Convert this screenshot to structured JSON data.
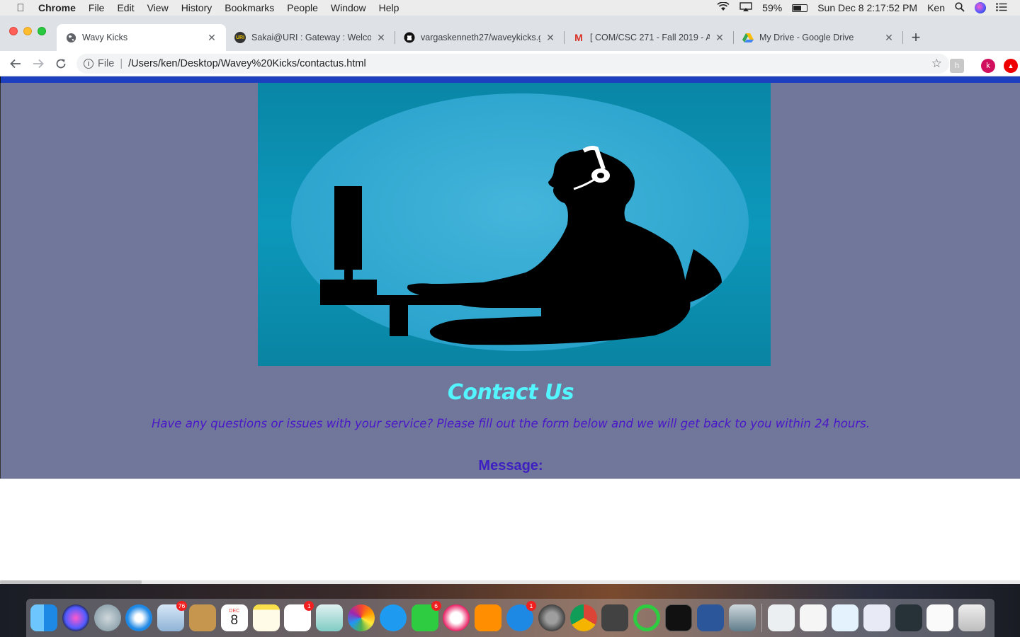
{
  "menubar": {
    "app_name": "Chrome",
    "menus": [
      "File",
      "Edit",
      "View",
      "History",
      "Bookmarks",
      "People",
      "Window",
      "Help"
    ],
    "battery": "59%",
    "clock": "Sun Dec 8  2:17:52 PM",
    "user": "Ken"
  },
  "browser": {
    "tabs": [
      {
        "title": "Wavy Kicks",
        "active": true
      },
      {
        "title": "Sakai@URI : Gateway : Welcome",
        "active": false
      },
      {
        "title": "vargaskenneth27/waveykicks.g",
        "active": false
      },
      {
        "title": "[ COM/CSC 271 - Fall 2019 - A",
        "active": false
      },
      {
        "title": "My Drive - Google Drive",
        "active": false
      }
    ],
    "address": {
      "scheme": "File",
      "path": "/Users/ken/Desktop/Wavey%20Kicks/contactus.html"
    },
    "profile_initial": "k"
  },
  "page": {
    "heading": "Contact Us",
    "subtext": "Have any questions or issues with your service? Please fill out the form below and we will get back to you within 24 hours.",
    "message_label": "Message:",
    "message_value": ""
  },
  "dock": {
    "badges": {
      "mail": "76",
      "reminders": "1",
      "facetime": "6",
      "appstore": "1"
    },
    "calendar_day": "8",
    "calendar_month": "DEC"
  },
  "colors": {
    "page_bg": "#71779b",
    "heading": "#53f5ff",
    "subtext": "#4a17c9",
    "top_bar": "#1c3fbf"
  }
}
